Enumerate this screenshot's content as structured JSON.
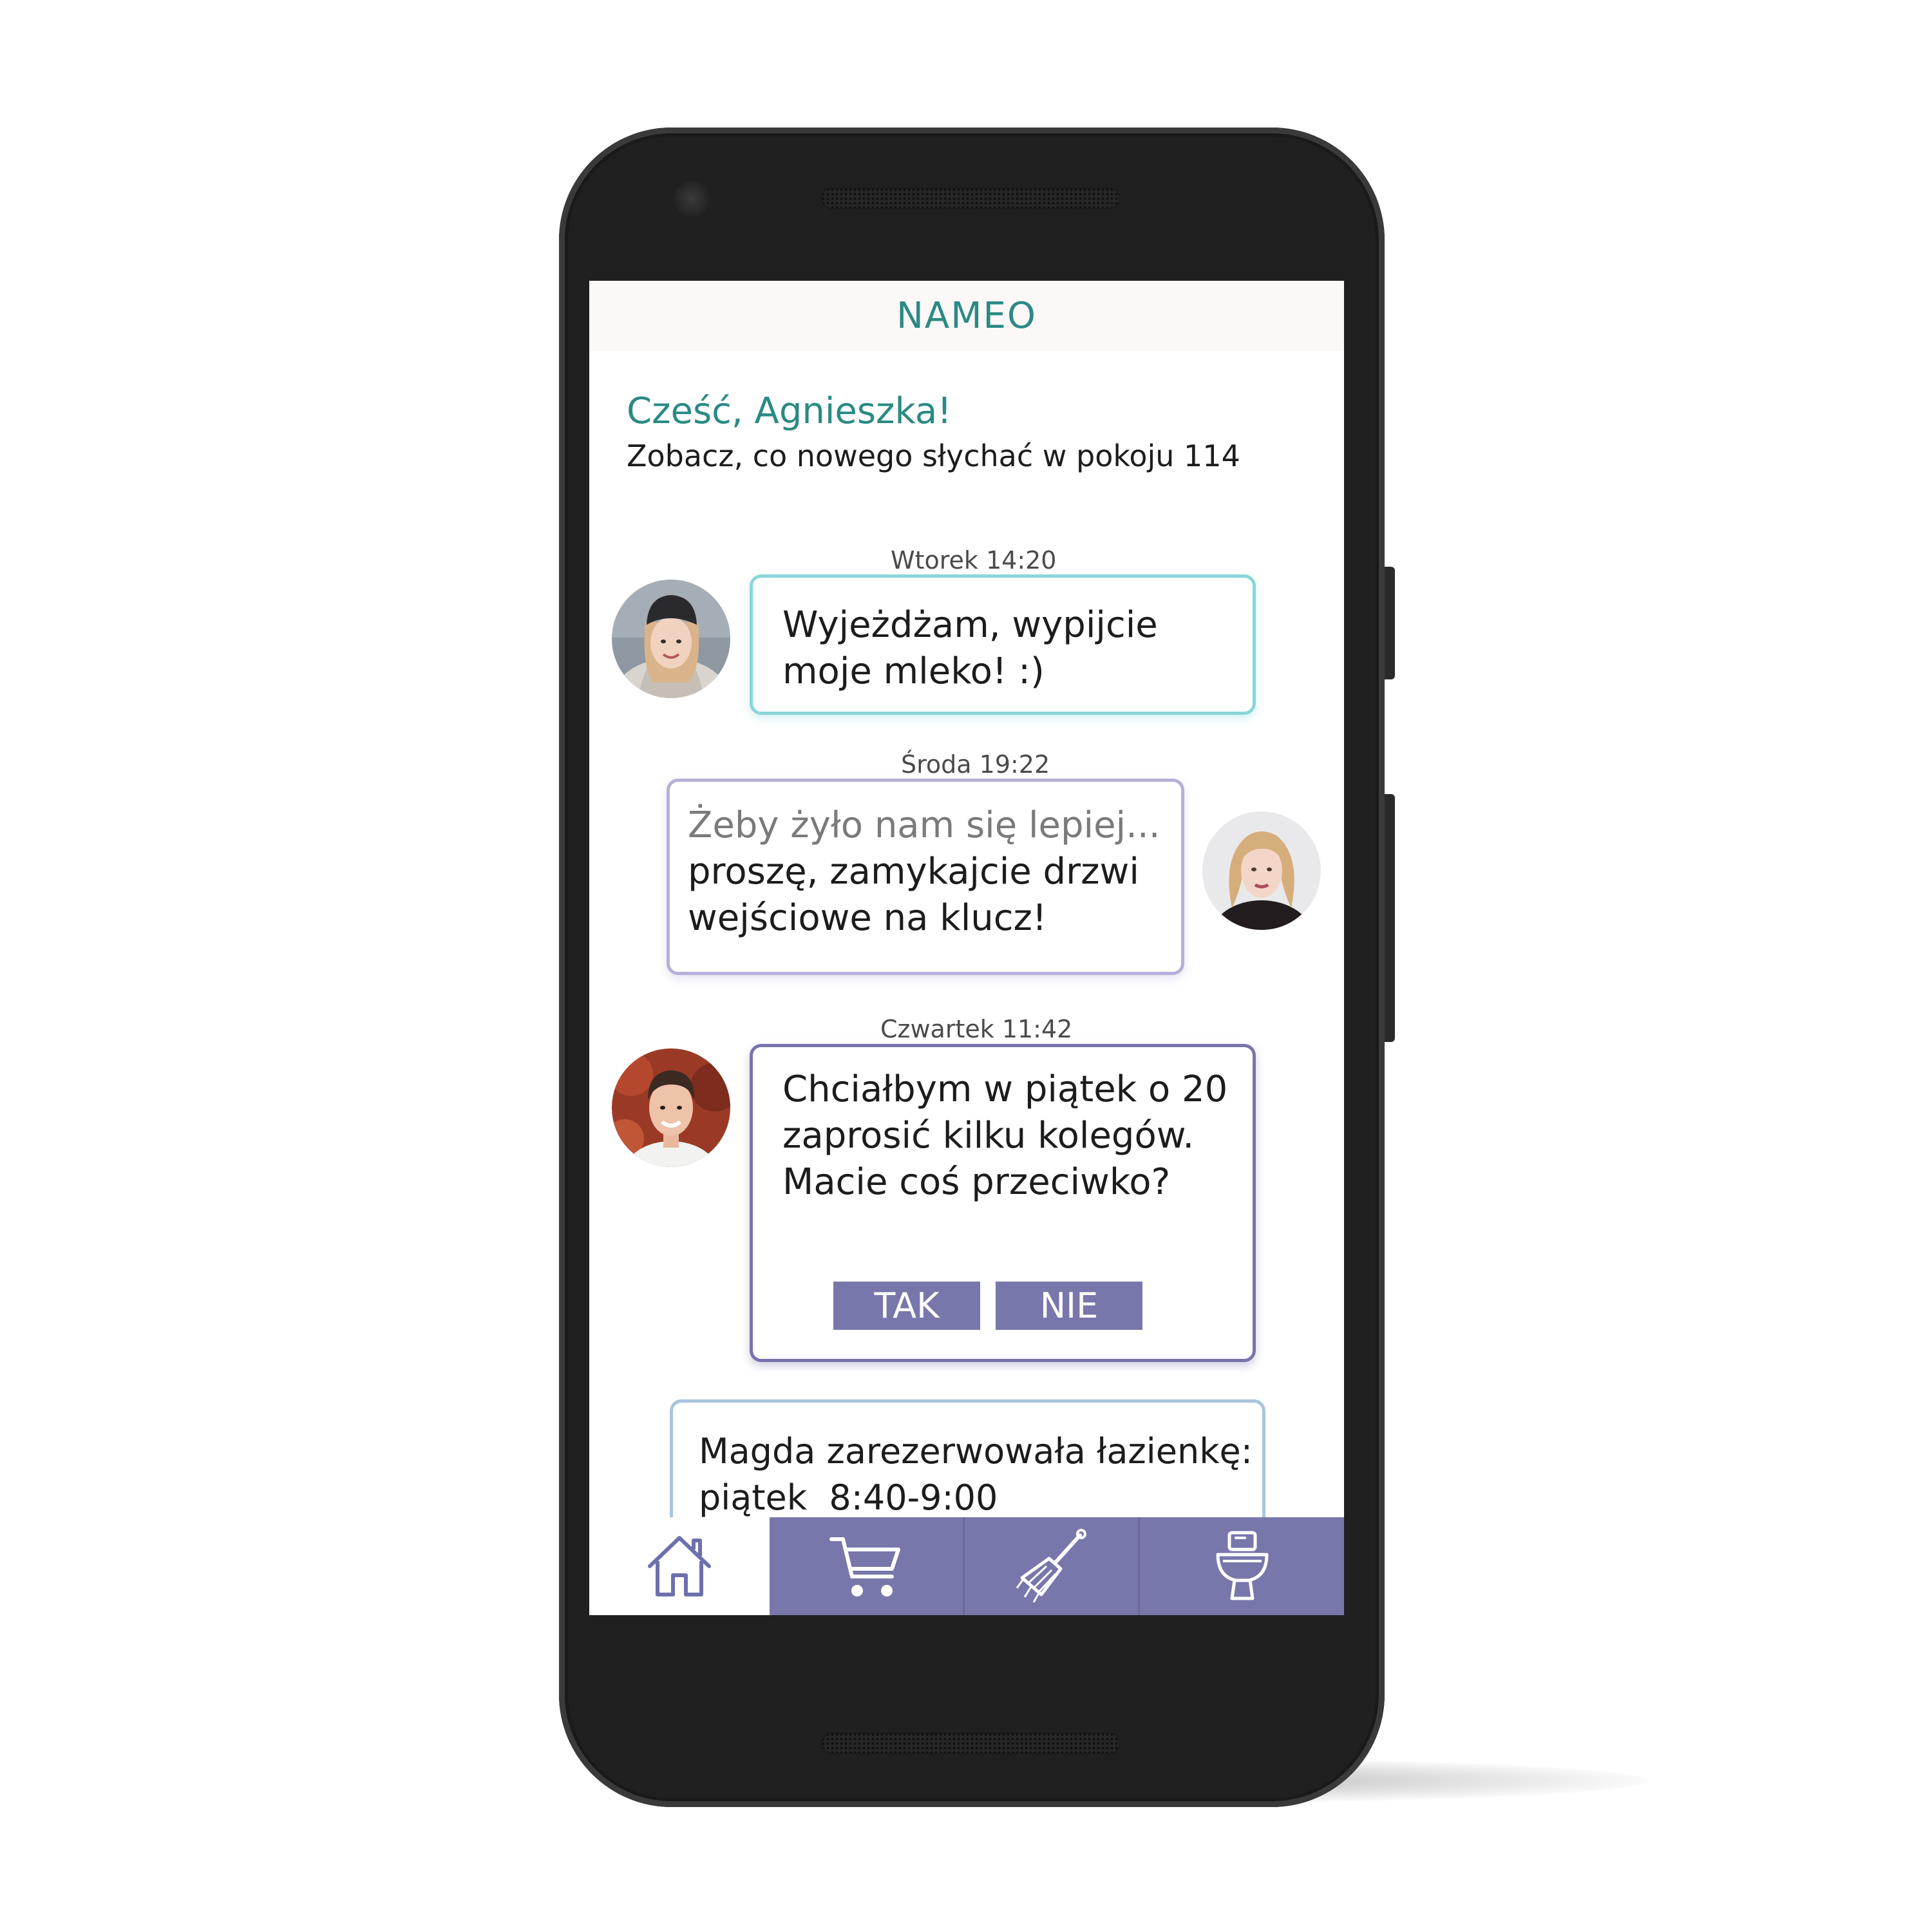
{
  "app": {
    "title": "NAMEO"
  },
  "greeting": {
    "title": "Cześć, Agnieszka!",
    "subtitle": "Zobacz, co nowego słychać w pokoju 114"
  },
  "messages": [
    {
      "timestamp": "Wtorek 14:20",
      "text": "Wyjeżdżam, wypijcie moje mleko! :)"
    },
    {
      "timestamp": "Środa 19:22",
      "text_muted": "Żeby żyło nam się lepiej...",
      "text": "proszę, zamykajcie drzwi wejściowe na klucz!"
    },
    {
      "timestamp": "Czwartek 11:42",
      "text": "Chciałbym w piątek o 20 zaprosić kilku kolegów. Macie coś przeciwko?",
      "options": [
        "TAK",
        "NIE"
      ]
    },
    {
      "text": "Magda zarezerwowała łazienkę:  piątek  8:40-9:00"
    }
  ],
  "nav": {
    "items": [
      {
        "icon": "home-icon",
        "active": true
      },
      {
        "icon": "shopping-cart-icon",
        "active": false
      },
      {
        "icon": "cleaning-broom-icon",
        "active": false
      },
      {
        "icon": "toilet-icon",
        "active": false
      }
    ]
  },
  "colors": {
    "accent_teal": "#2a8a84",
    "nav_purple": "#7877ab",
    "bubble1_border": "#8ad6d9",
    "bubble2_border": "#b5b0d8",
    "bubble3_border": "#7873ac",
    "bubble4_border": "#a9c4de"
  }
}
